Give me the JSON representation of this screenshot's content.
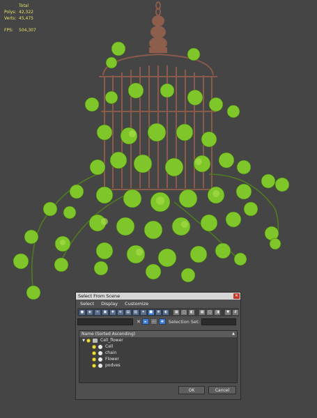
{
  "viewport": {
    "stats": {
      "header": "Total",
      "rows": [
        {
          "label": "Polys:",
          "value": "42,322"
        },
        {
          "label": "Verts:",
          "value": "45,475"
        }
      ],
      "fps_label": "FPS:",
      "fps_value": "504,307"
    },
    "colors": {
      "background": "#454545",
      "stats_text": "#e8e36a",
      "cage": "#8a5a4a",
      "leaf": "#7fc62a"
    }
  },
  "dialog": {
    "title": "Select From Scene",
    "close_icon": "close-icon",
    "menu": [
      "Select",
      "Display",
      "Customize"
    ],
    "selection_set_label": "Selection Set:",
    "list_header": "Name (Sorted Ascending)",
    "tree": [
      {
        "name": "Cell_flower",
        "level": 0,
        "expanded": true
      },
      {
        "name": "Cell",
        "level": 1
      },
      {
        "name": "chain",
        "level": 1
      },
      {
        "name": "Flower",
        "level": 1
      },
      {
        "name": "podves",
        "level": 1
      }
    ],
    "ok_label": "OK",
    "cancel_label": "Cancel"
  }
}
